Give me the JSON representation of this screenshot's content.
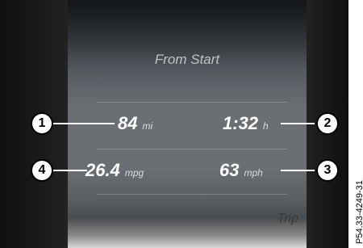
{
  "screen": {
    "title": "From Start",
    "footer_label": "Trip"
  },
  "readings": {
    "distance": {
      "value": "84",
      "unit": "mi",
      "callout": "1"
    },
    "time": {
      "value": "1:32",
      "unit": "h",
      "callout": "2"
    },
    "speed": {
      "value": "63",
      "unit": "mph",
      "callout": "3"
    },
    "consumption": {
      "value": "26.4",
      "unit": "mpg",
      "callout": "4"
    }
  },
  "figure_ref": "P54.33-4249-31",
  "colors": {
    "value_text": "#ffffff",
    "callout_fill": "#ffffff",
    "callout_border": "#000000"
  }
}
